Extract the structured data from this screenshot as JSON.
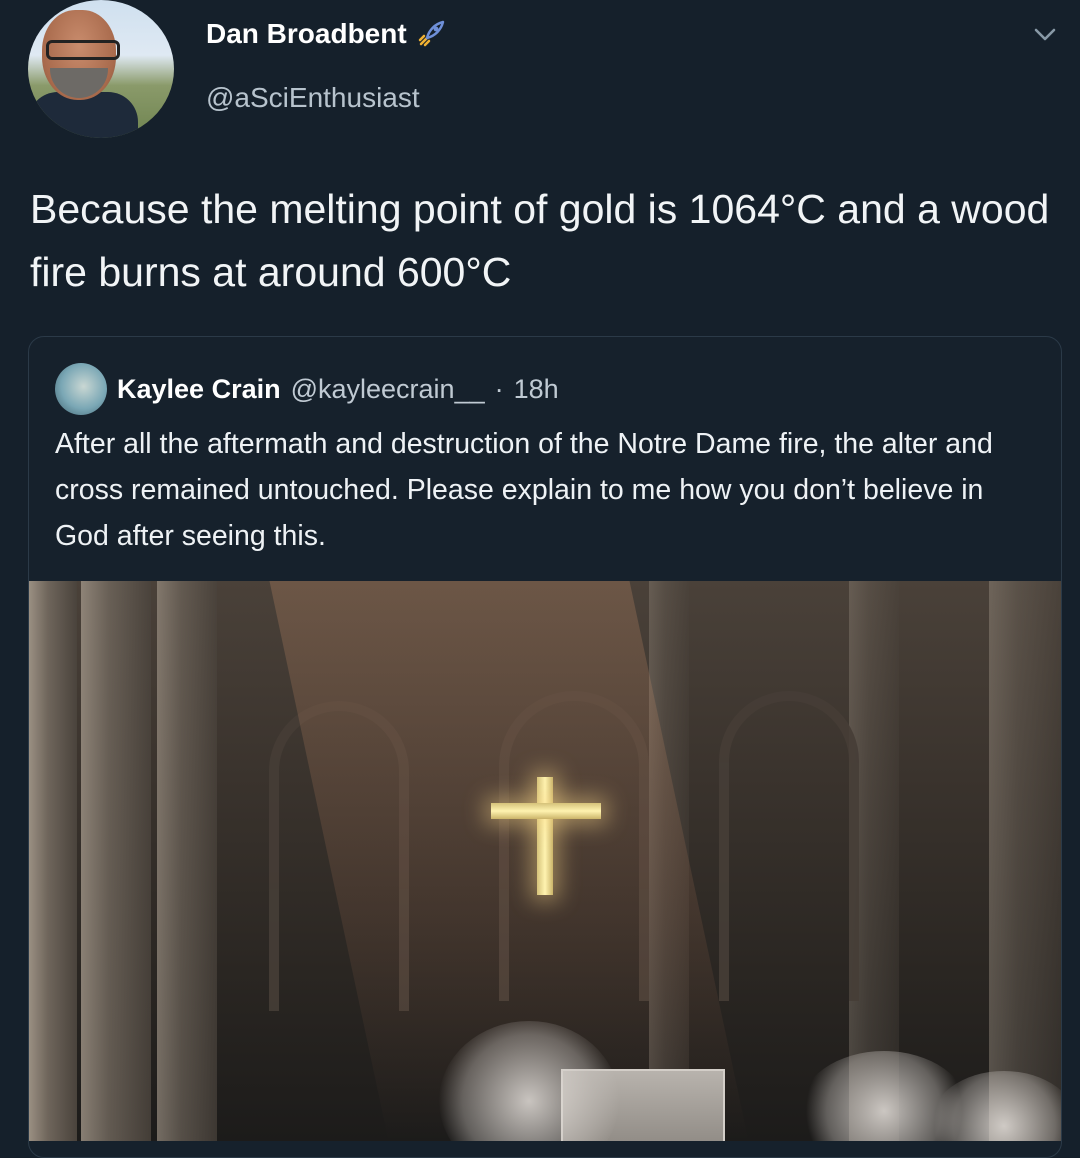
{
  "tweet": {
    "display_name": "Dan Broadbent",
    "handle": "@aSciEnthusiast",
    "badge_icon": "rocket-icon",
    "menu_icon": "chevron-down-icon",
    "text": "Because the melting point of gold is 1064°C and a wood fire burns at around 600°C"
  },
  "quoted_tweet": {
    "display_name": "Kaylee Crain",
    "handle": "@kayleecrain__",
    "separator": "·",
    "time": "18h",
    "text": "After all the aftermath and destruction of the Notre Dame fire, the alter and cross remained untouched. Please explain to me how you don’t believe in God after seeing this."
  },
  "colors": {
    "background": "#15202b",
    "text_primary": "#ffffff",
    "text_secondary": "#b7c3cd"
  }
}
